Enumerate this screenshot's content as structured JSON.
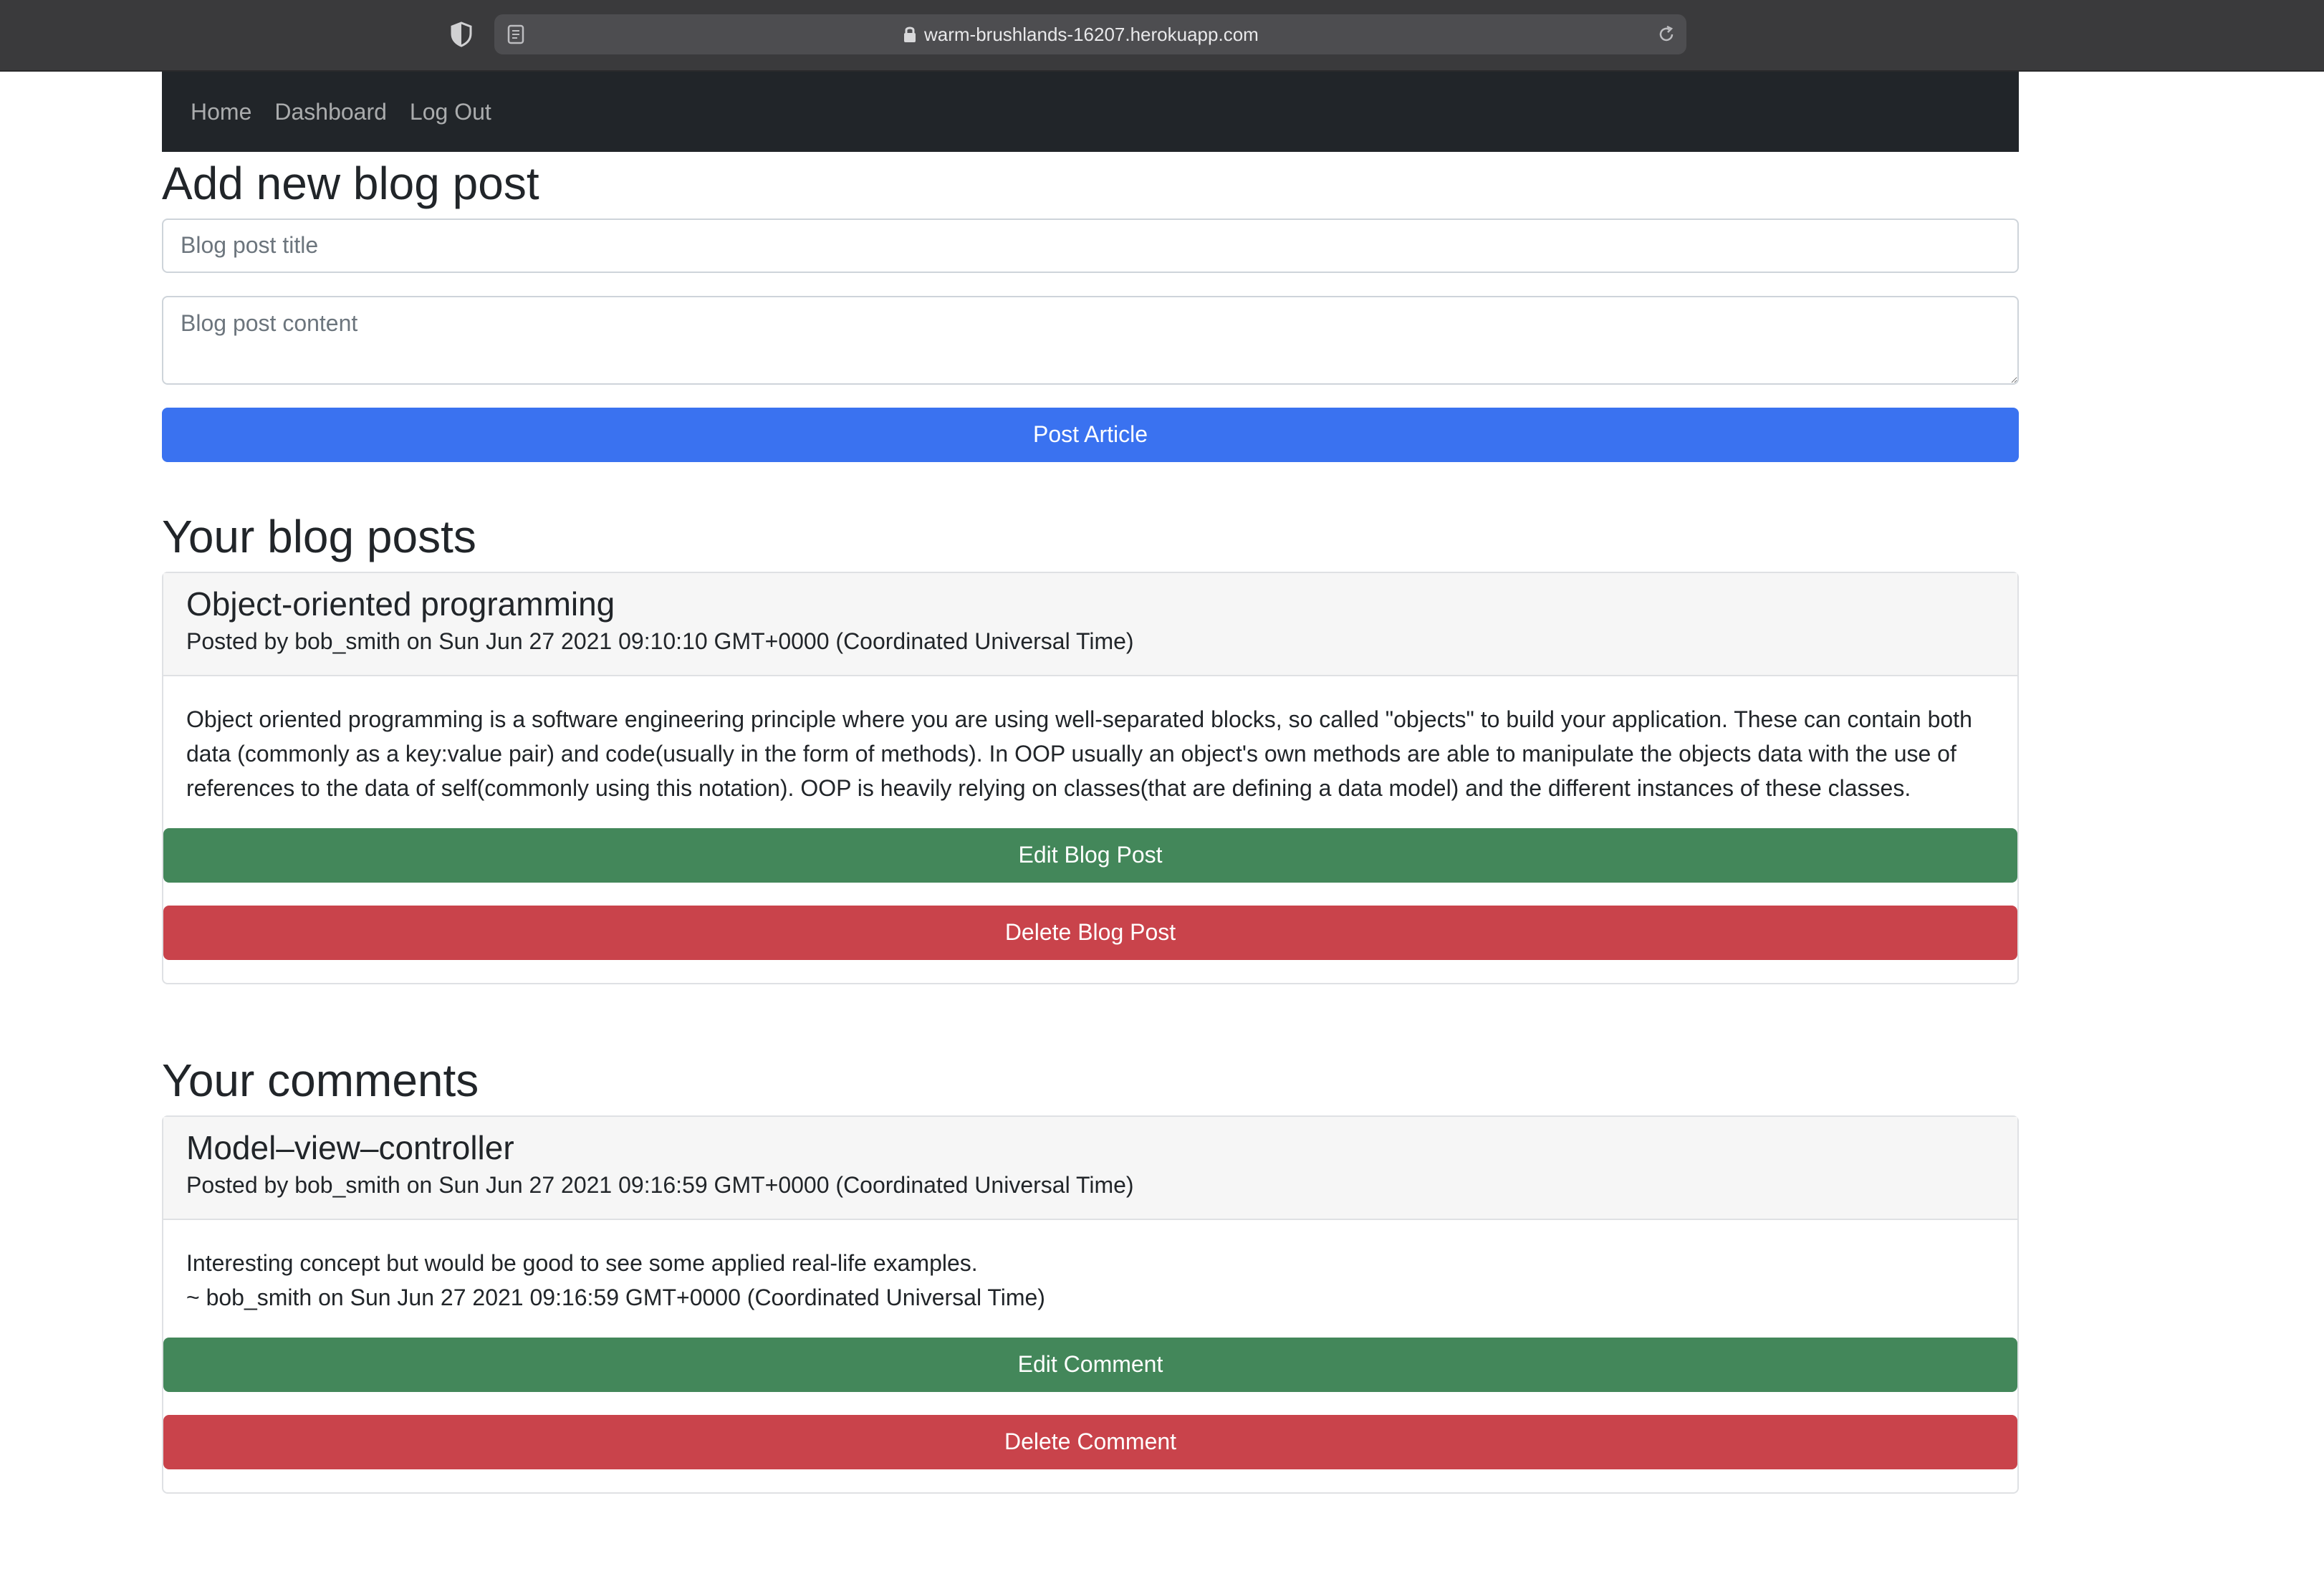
{
  "browser": {
    "url": "warm-brushlands-16207.herokuapp.com"
  },
  "nav": {
    "items": [
      "Home",
      "Dashboard",
      "Log Out"
    ]
  },
  "new_post": {
    "heading": "Add new blog post",
    "title_placeholder": "Blog post title",
    "content_placeholder": "Blog post content",
    "submit_label": "Post Article"
  },
  "posts_section": {
    "heading": "Your blog posts",
    "posts": [
      {
        "title": "Object-oriented programming",
        "meta": "Posted by bob_smith on Sun Jun 27 2021 09:10:10 GMT+0000 (Coordinated Universal Time)",
        "body": "Object oriented programming is a software engineering principle where you are using well-separated blocks, so called \"objects\" to build your application. These can contain both data (commonly as a key:value pair) and code(usually in the form of methods). In OOP usually an object's own methods are able to manipulate the objects data with the use of references to the data of self(commonly using this notation). OOP is heavily relying on classes(that are defining a data model) and the different instances of these classes.",
        "edit_label": "Edit Blog Post",
        "delete_label": "Delete Blog Post"
      }
    ]
  },
  "comments_section": {
    "heading": "Your comments",
    "comments": [
      {
        "post_title": "Model–view–controller",
        "meta": "Posted by bob_smith on Sun Jun 27 2021 09:16:59 GMT+0000 (Coordinated Universal Time)",
        "text": "Interesting concept but would be good to see some applied real-life examples.",
        "byline": "~ bob_smith on Sun Jun 27 2021 09:16:59 GMT+0000 (Coordinated Universal Time)",
        "edit_label": "Edit Comment",
        "delete_label": "Delete Comment"
      }
    ]
  },
  "colors": {
    "navbar_bg": "#212529",
    "primary": "#3a72f0",
    "success": "#43875a",
    "danger": "#c9434b"
  },
  "icons": {
    "privacy": "shield-icon",
    "reader": "reader-mode-icon",
    "lock": "lock-icon",
    "reload": "reload-icon"
  }
}
